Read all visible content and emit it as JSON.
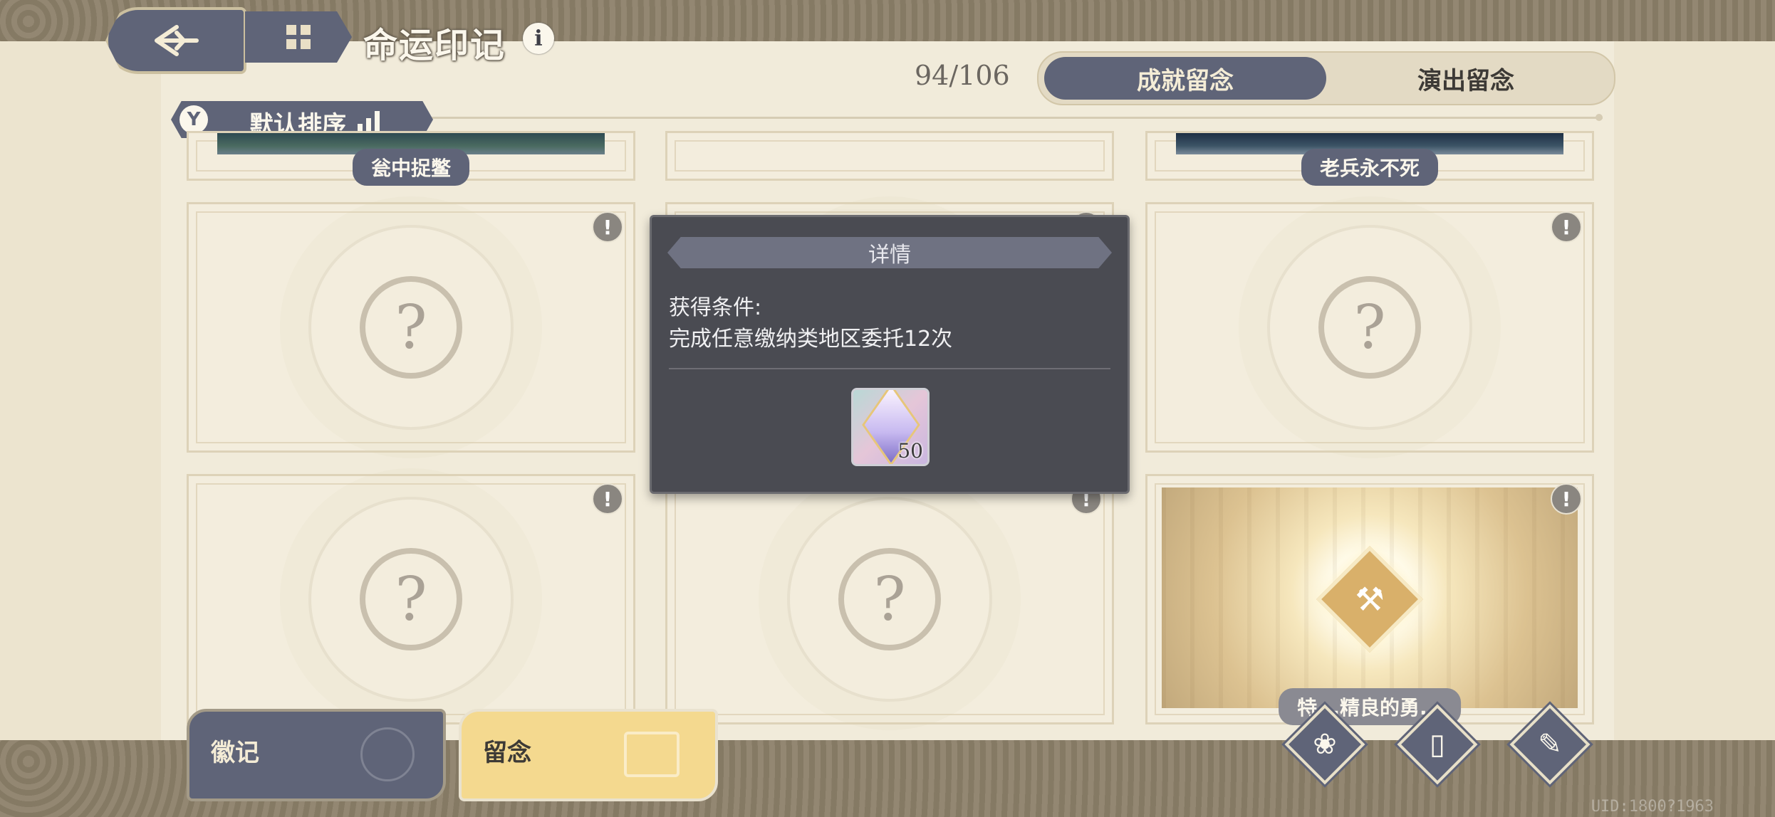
{
  "header": {
    "title": "命运印记",
    "info_icon": "i",
    "progress": "94/106",
    "tabs": [
      {
        "label": "成就留念",
        "active": true
      },
      {
        "label": "演出留念",
        "active": false
      }
    ]
  },
  "sort": {
    "label": "默认排序",
    "filter_icon": "filter-icon"
  },
  "cards_top_row": [
    {
      "label": "瓮中捉鳖"
    },
    {
      "label": ""
    },
    {
      "label": "老兵永不死"
    }
  ],
  "cards": {
    "locked_mark": "?",
    "alert_mark": "!",
    "partial_label": "特...精良的勇..."
  },
  "popup": {
    "title": "详情",
    "condition_title": "获得条件:",
    "condition_text": "完成任意缴纳类地区委托12次",
    "reward_count": "50"
  },
  "bottom_nav": {
    "badge_label": "徽记",
    "memento_label": "留念",
    "icons": [
      "bell-flower-icon",
      "book-icon",
      "scroll-icon"
    ]
  },
  "uid": "UID:1800?1963"
}
